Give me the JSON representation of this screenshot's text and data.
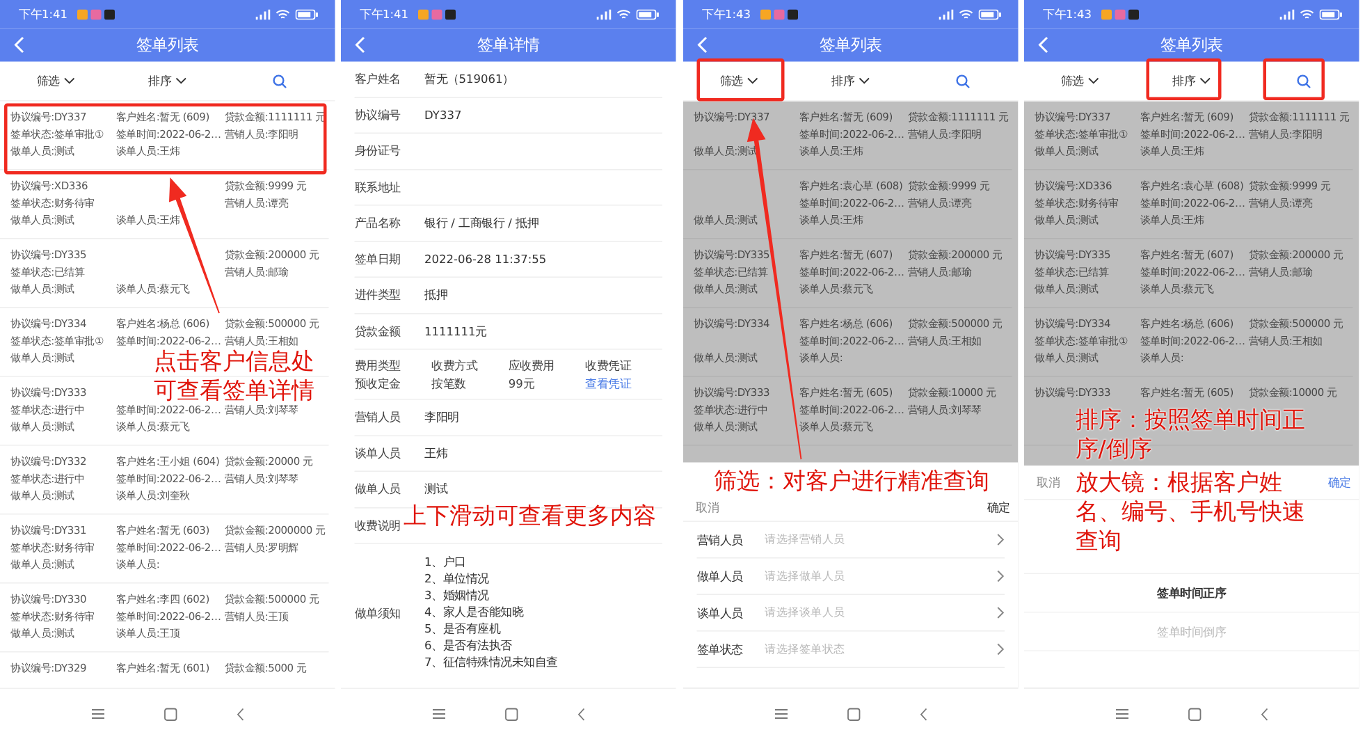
{
  "screens": [
    {
      "kind": "list",
      "time": "下午1:41",
      "title": "签单列表",
      "filter": "筛选",
      "sort": "排序",
      "callouts": [
        "点击客户信息处可查看签单详情"
      ],
      "records": [
        {
          "no": "协议编号:DY337",
          "customer": "客户姓名:暂无 (609)",
          "amount": "贷款金额:1111111 元",
          "status": "签单状态:签单审批①",
          "time": "签单时间:2022-06-2…",
          "sales": "营销人员:李阳明",
          "maker": "做单人员:测试",
          "talker": "谈单人员:王炜"
        },
        {
          "no": "协议编号:XD336",
          "amount": "贷款金额:9999 元",
          "status": "签单状态:财务待审",
          "sales": "营销人员:谭亮",
          "maker": "做单人员:测试",
          "talker": "谈单人员:王炜"
        },
        {
          "no": "协议编号:DY335",
          "amount": "贷款金额:200000 元",
          "status": "签单状态:已结算",
          "sales": "营销人员:邮瑜",
          "maker": "做单人员:测试",
          "talker": "谈单人员:蔡元飞"
        },
        {
          "no": "协议编号:DY334",
          "customer": "客户姓名:杨总 (606)",
          "amount": "贷款金额:500000 元",
          "status": "签单状态:签单审批①",
          "time": "签单时间:2022-06-2…",
          "sales": "营销人员:王相如",
          "maker": "做单人员:测试"
        },
        {
          "no": "协议编号:DY333",
          "status": "签单状态:进行中",
          "time": "签单时间:2022-06-2…",
          "sales": "营销人员:刘琴琴",
          "maker": "做单人员:测试",
          "talker": "谈单人员:蔡元飞"
        },
        {
          "no": "协议编号:DY332",
          "customer": "客户姓名:王小姐 (604)",
          "amount": "贷款金额:20000 元",
          "status": "签单状态:进行中",
          "time": "签单时间:2022-06-2…",
          "sales": "营销人员:刘琴琴",
          "maker": "做单人员:测试",
          "talker": "谈单人员:刘奎秋"
        },
        {
          "no": "协议编号:DY331",
          "customer": "客户姓名:暂无 (603)",
          "amount": "贷款金额:2000000 元",
          "status": "签单状态:财务待审",
          "time": "签单时间:2022-06-2…",
          "sales": "营销人员:罗明辉",
          "maker": "做单人员:测试",
          "talker": "谈单人员:"
        },
        {
          "no": "协议编号:DY330",
          "customer": "客户姓名:李四 (602)",
          "amount": "贷款金额:500000 元",
          "status": "签单状态:财务待审",
          "time": "签单时间:2022-06-2…",
          "sales": "营销人员:王顶",
          "maker": "做单人员:测试",
          "talker": "谈单人员:王顶"
        },
        {
          "no": "协议编号:DY329",
          "customer": "客户姓名:暂无 (601)",
          "amount": "贷款金额:5000 元"
        }
      ]
    },
    {
      "kind": "detail",
      "time": "下午1:41",
      "title": "签单详情",
      "callouts": [
        "上下滑动可查看更多内容"
      ],
      "rows": [
        {
          "kind": "field",
          "label": "客户姓名",
          "value": "暂无（519061）"
        },
        {
          "kind": "field",
          "label": "协议编号",
          "value": "DY337"
        },
        {
          "kind": "field",
          "label": "身份证号"
        },
        {
          "kind": "field",
          "label": "联系地址"
        },
        {
          "kind": "field",
          "label": "产品名称",
          "value": "银行 / 工商银行 / 抵押"
        },
        {
          "kind": "field",
          "label": "签单日期",
          "value": "2022-06-28 11:37:55"
        },
        {
          "kind": "field",
          "label": "进件类型",
          "value": "抵押"
        },
        {
          "kind": "field",
          "label": "贷款金额",
          "value": "1111111元"
        },
        {
          "kind": "fees",
          "columns": [
            {
              "header": "费用类型",
              "value": "预收定金"
            },
            {
              "header": "收费方式",
              "value": "按笔数"
            },
            {
              "header": "应收费用",
              "value": "99元"
            },
            {
              "header": "收费凭证",
              "link": "查看凭证"
            }
          ]
        },
        {
          "kind": "field",
          "label": "营销人员",
          "value": "李阳明"
        },
        {
          "kind": "field",
          "label": "谈单人员",
          "value": "王炜"
        },
        {
          "kind": "field",
          "label": "做单人员",
          "value": "测试"
        },
        {
          "kind": "field",
          "label": "收费说明"
        },
        {
          "kind": "notes",
          "label": "做单须知",
          "items": [
            "1、户口",
            "2、单位情况",
            "3、婚姻情况",
            "4、家人是否能知晓",
            "5、是否有座机",
            "6、是否有法执否",
            "7、征信特殊情况未知自查"
          ]
        }
      ]
    },
    {
      "kind": "list",
      "time": "下午1:43",
      "title": "签单列表",
      "filter": "筛选",
      "sort": "排序",
      "callouts": [
        "筛选：对客户进行精准查询"
      ],
      "records": [
        {
          "no": "协议编号:DY337",
          "customer": "客户姓名:暂无 (609)",
          "amount": "贷款金额:1111111 元",
          "time": "签单时间:2022-06-2…",
          "sales": "营销人员:李阳明",
          "maker": "做单人员:测试",
          "talker": "谈单人员:王炜"
        },
        {
          "customer": "客户姓名:袁心草 (608)",
          "amount": "贷款金额:9999 元",
          "time": "签单时间:2022-06-2…",
          "sales": "营销人员:谭亮",
          "maker": "做单人员:测试",
          "talker": "谈单人员:王炜"
        },
        {
          "no": "协议编号:DY335",
          "customer": "客户姓名:暂无 (607)",
          "amount": "贷款金额:200000 元",
          "status": "签单状态:已结算",
          "time": "签单时间:2022-06-2…",
          "sales": "营销人员:邮瑜",
          "maker": "做单人员:测试",
          "talker": "谈单人员:蔡元飞"
        },
        {
          "no": "协议编号:DY334",
          "customer": "客户姓名:杨总 (606)",
          "amount": "贷款金额:500000 元",
          "time": "签单时间:2022-06-2…",
          "sales": "营销人员:王相如",
          "maker": "做单人员:测试",
          "talker": "谈单人员:"
        },
        {
          "no": "协议编号:DY333",
          "customer": "客户姓名:暂无 (605)",
          "amount": "贷款金额:10000 元",
          "status": "签单状态:进行中",
          "time": "签单时间:2022-06-2…",
          "sales": "营销人员:刘琴琴",
          "maker": "做单人员:测试",
          "talker": "谈单人员:蔡元飞"
        }
      ],
      "sheet": {
        "kind": "filter",
        "cancel": "取消",
        "confirm": "确定",
        "rows": [
          {
            "label": "营销人员",
            "placeholder": "请选择营销人员"
          },
          {
            "label": "做单人员",
            "placeholder": "请选择做单人员"
          },
          {
            "label": "谈单人员",
            "placeholder": "请选择谈单人员"
          },
          {
            "label": "签单状态",
            "placeholder": "请选择签单状态"
          }
        ]
      }
    },
    {
      "kind": "list",
      "time": "下午1:43",
      "title": "签单列表",
      "filter": "筛选",
      "sort": "排序",
      "callouts": [
        "排序：按照签单时间正序/倒序",
        "放大镜：根据客户姓名、编号、手机号快速查询"
      ],
      "records": [
        {
          "no": "协议编号:DY337",
          "customer": "客户姓名:暂无 (609)",
          "amount": "贷款金额:1111111 元",
          "status": "签单状态:签单审批①",
          "time": "签单时间:2022-06-2…",
          "sales": "营销人员:李阳明",
          "maker": "做单人员:测试",
          "talker": "谈单人员:王炜"
        },
        {
          "no": "协议编号:XD336",
          "customer": "客户姓名:袁心草 (608)",
          "amount": "贷款金额:9999 元",
          "status": "签单状态:财务待审",
          "time": "签单时间:2022-06-2…",
          "sales": "营销人员:谭亮",
          "maker": "做单人员:测试",
          "talker": "谈单人员:王炜"
        },
        {
          "no": "协议编号:DY335",
          "customer": "客户姓名:暂无 (607)",
          "amount": "贷款金额:200000 元",
          "status": "签单状态:已结算",
          "time": "签单时间:2022-06-2…",
          "sales": "营销人员:邮瑜",
          "maker": "做单人员:测试",
          "talker": "谈单人员:蔡元飞"
        },
        {
          "no": "协议编号:DY334",
          "customer": "客户姓名:杨总 (606)",
          "amount": "贷款金额:500000 元",
          "status": "签单状态:签单审批①",
          "time": "签单时间:2022-06-2…",
          "sales": "营销人员:王相如",
          "maker": "做单人员:测试",
          "talker": "谈单人员:"
        },
        {
          "no": "协议编号:DY333",
          "customer": "客户姓名:暂无 (605)",
          "amount": "贷款金额:10000 元"
        }
      ],
      "sheet": {
        "kind": "sort",
        "cancel": "取消",
        "confirm": "确定",
        "options": [
          {
            "label": "签单时间正序",
            "selected": true
          },
          {
            "label": "签单时间倒序",
            "selected": false
          }
        ]
      }
    }
  ]
}
